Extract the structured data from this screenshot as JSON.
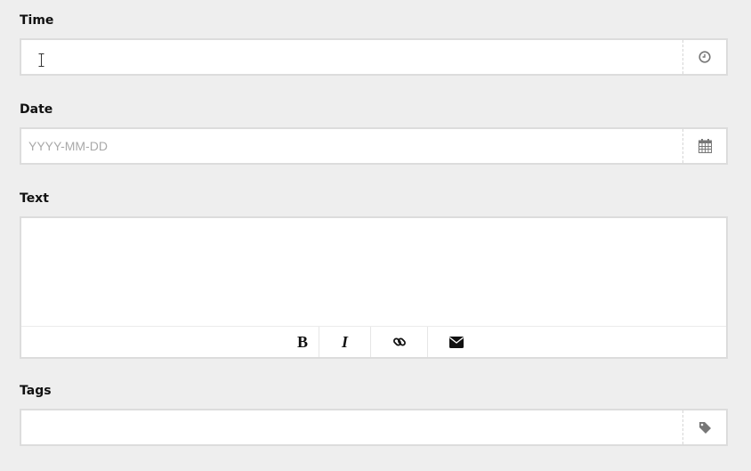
{
  "fields": {
    "time": {
      "label": "Time",
      "value": "",
      "placeholder": "",
      "icon": "clock-icon"
    },
    "date": {
      "label": "Date",
      "value": "",
      "placeholder": "YYYY-MM-DD",
      "icon": "calendar-icon"
    },
    "text": {
      "label": "Text",
      "value": ""
    },
    "tags": {
      "label": "Tags",
      "value": "",
      "placeholder": "",
      "icon": "tag-icon"
    }
  },
  "toolbar": {
    "bold_label": "B",
    "italic_label": "I",
    "link_icon": "link-icon",
    "email_icon": "envelope-icon"
  },
  "colors": {
    "background": "#eeeeee",
    "field_border": "#dcdcdc",
    "icon": "#777777",
    "placeholder": "#a9a9a9"
  }
}
